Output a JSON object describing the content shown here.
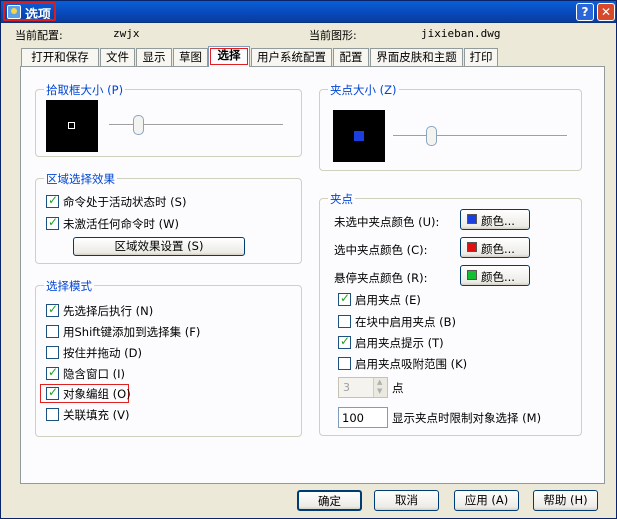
{
  "window": {
    "title": "选项"
  },
  "meta": {
    "profile_label": "当前配置:",
    "profile_value": "zwjx",
    "drawing_label": "当前图形:",
    "drawing_value": "jixieban.dwg"
  },
  "tabs": [
    "打开和保存",
    "文件",
    "显示",
    "草图",
    "选择",
    "用户系统配置",
    "配置",
    "界面皮肤和主题",
    "打印"
  ],
  "pickbox": {
    "title": "拾取框大小 (P)",
    "level": 0.15
  },
  "grip_size": {
    "title": "夹点大小 (Z)",
    "level": 0.2
  },
  "area_selection": {
    "title": "区域选择效果",
    "options": [
      {
        "label": "命令处于活动状态时 (S)",
        "checked": true
      },
      {
        "label": "未激活任何命令时 (W)",
        "checked": true
      }
    ],
    "settings_button": "区域效果设置 (S)"
  },
  "selection_modes": {
    "title": "选择模式",
    "options": [
      {
        "label": "先选择后执行 (N)",
        "checked": true
      },
      {
        "label": "用Shift键添加到选择集 (F)",
        "checked": false
      },
      {
        "label": "按住并拖动 (D)",
        "checked": false
      },
      {
        "label": "隐含窗口 (I)",
        "checked": true
      },
      {
        "label": "对象编组 (O)",
        "checked": true
      },
      {
        "label": "关联填充 (V)",
        "checked": false
      }
    ]
  },
  "grips": {
    "title": "夹点",
    "unselected_label": "未选中夹点颜色 (U):",
    "selected_label": "选中夹点颜色 (C):",
    "hover_label": "悬停夹点颜色 (R):",
    "color_button": "颜色...",
    "colors": {
      "unselected": "#1a3ee0",
      "selected": "#e01010",
      "hover": "#10c030"
    },
    "options": [
      {
        "label": "启用夹点 (E)",
        "checked": true
      },
      {
        "label": "在块中启用夹点 (B)",
        "checked": false
      },
      {
        "label": "启用夹点提示 (T)",
        "checked": true
      },
      {
        "label": "启用夹点吸附范围 (K)",
        "checked": false
      }
    ],
    "grip_count_value": "3",
    "grip_count_unit": "点",
    "limit_value": "100",
    "limit_label": "显示夹点时限制对象选择 (M)"
  },
  "buttons": {
    "ok": "确定",
    "cancel": "取消",
    "apply": "应用 (A)",
    "help": "帮助 (H)"
  }
}
